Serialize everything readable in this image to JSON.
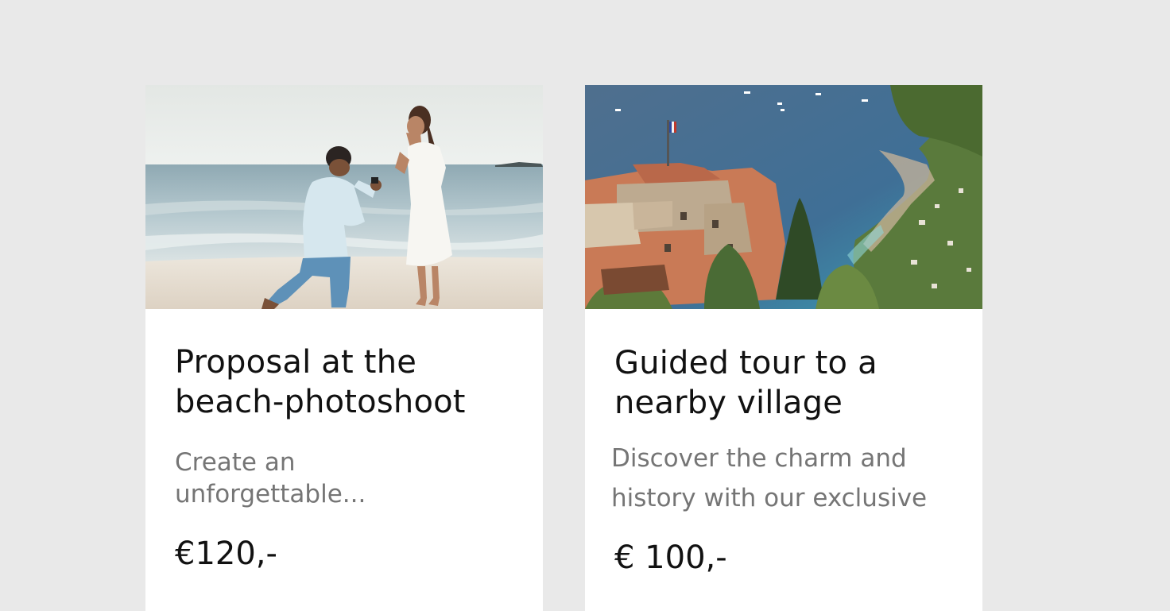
{
  "cards": [
    {
      "title": "Proposal at the beach-photoshoot",
      "description": "Create an unforgettable...",
      "price": "€120,-",
      "image": "beach-proposal-photo"
    },
    {
      "title": "Guided tour to a nearby village",
      "description_lines": [
        "Discover the charm and",
        "history with our exclusive"
      ],
      "price": "€ 100,-",
      "image": "coastal-village-photo"
    }
  ]
}
